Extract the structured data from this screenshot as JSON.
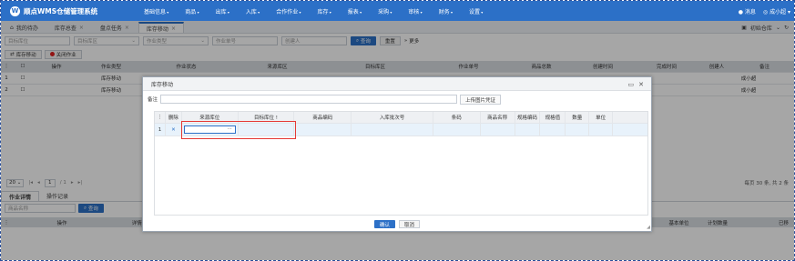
{
  "header": {
    "logo_mark": "W",
    "app_title": "顺点WMS仓储管理系统",
    "menus": [
      "基础信息",
      "商品",
      "出库",
      "入库",
      "合作作业",
      "库存",
      "报表",
      "采购",
      "审核",
      "财务",
      "设置"
    ],
    "message": "消息",
    "user": "成小超",
    "accent": "#2c70c7"
  },
  "tabs": {
    "home": "我的待办",
    "items": [
      {
        "label": "库存总查"
      },
      {
        "label": "盘点任务"
      },
      {
        "label": "库存移动"
      }
    ],
    "warehouse": "初始仓库"
  },
  "filters": {
    "from_location": "目标库位",
    "to_area": "目标库区",
    "job_type": "作业类型",
    "job_no": "作业单号",
    "creator": "创建人",
    "search": "查询",
    "reset": "重置",
    "more": "更多"
  },
  "actions": {
    "stock_move": "库存移动",
    "close_job": "关闭作业"
  },
  "main_grid": {
    "columns": [
      "",
      "",
      "操作",
      "作业类型",
      "作业状态",
      "来源库区",
      "目标库区",
      "作业单号",
      "商品总数",
      "创建时间",
      "完成时间",
      "创建人",
      "备注"
    ],
    "rows": [
      {
        "num": "1",
        "job_type": "库存移动",
        "creator": "成小超"
      },
      {
        "num": "2",
        "job_type": "库存移动",
        "creator": "成小超"
      }
    ]
  },
  "pager": {
    "page_size": "20",
    "page_input": "1",
    "page_total": "/ 1",
    "summary": "每页 30 条, 共 2 条"
  },
  "detail": {
    "tabs": [
      "作业详情",
      "操作记录"
    ],
    "search_placeholder": "商品名称",
    "search": "查询",
    "columns": [
      "操作",
      "详情状",
      "基本单位",
      "计划数量",
      "已移"
    ]
  },
  "modal": {
    "title": "库存移动",
    "remark_label": "备注",
    "upload": "上传图片凭证",
    "columns": [
      "删除",
      "来源库位",
      "目标库位 !",
      "商品编码",
      "入库批次号",
      "条码",
      "商品名称",
      "规格编码",
      "规格值",
      "数量",
      "单位"
    ],
    "row": {
      "num": "1",
      "delete": "✕",
      "editor_value": "···"
    },
    "confirm": "确认",
    "cancel": "取消"
  }
}
